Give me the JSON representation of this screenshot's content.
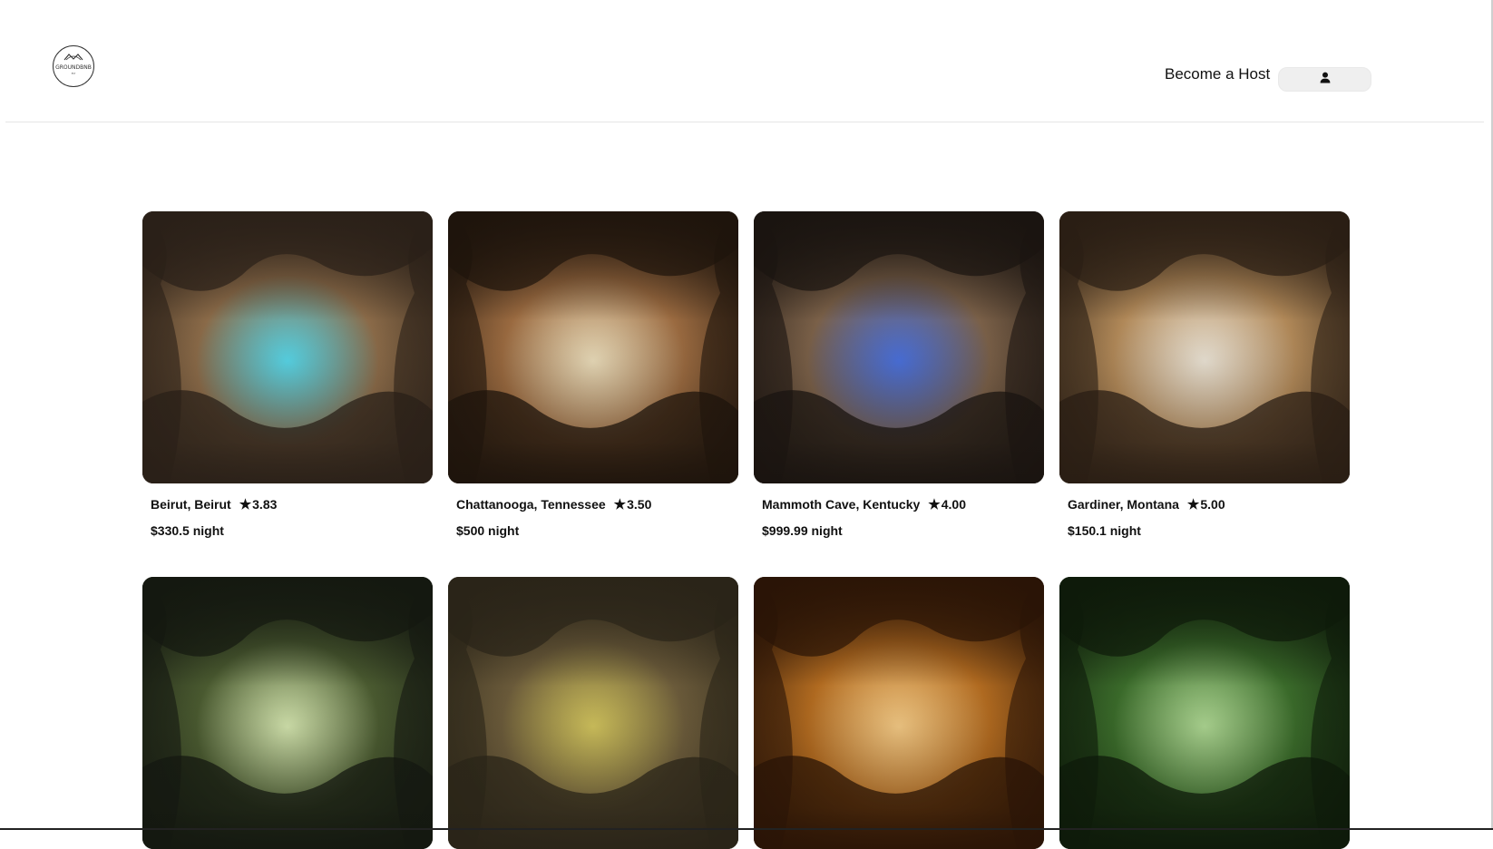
{
  "header": {
    "logo_text": "GROUNDBNB",
    "become_host_label": "Become a Host",
    "profile_icon": "user-icon"
  },
  "listings": [
    {
      "location": "Beirut, Beirut",
      "rating": "3.83",
      "price": "$330.5 night",
      "theme": [
        "#2a2018",
        "#8a6a48",
        "#39d0e6"
      ]
    },
    {
      "location": "Chattanooga, Tennessee",
      "rating": "3.50",
      "price": "$500 night",
      "theme": [
        "#1e140c",
        "#9a6a40",
        "#e8d8b0"
      ]
    },
    {
      "location": "Mammoth Cave, Kentucky",
      "rating": "4.00",
      "price": "$999.99 night",
      "theme": [
        "#1a1410",
        "#7a6048",
        "#2a58d8"
      ]
    },
    {
      "location": "Gardiner, Montana",
      "rating": "5.00",
      "price": "$150.1 night",
      "theme": [
        "#2a1e14",
        "#b08858",
        "#e8e0d0"
      ]
    },
    {
      "location": "",
      "rating": "",
      "price": "",
      "theme": [
        "#141810",
        "#4a5a30",
        "#cce0a0"
      ]
    },
    {
      "location": "",
      "rating": "",
      "price": "",
      "theme": [
        "#2a2418",
        "#6a5a3a",
        "#c8b840"
      ]
    },
    {
      "location": "",
      "rating": "",
      "price": "",
      "theme": [
        "#2a1406",
        "#b06a20",
        "#f0c070"
      ]
    },
    {
      "location": "",
      "rating": "",
      "price": "",
      "theme": [
        "#0e1a0a",
        "#3a6a2a",
        "#a0d080"
      ]
    }
  ]
}
